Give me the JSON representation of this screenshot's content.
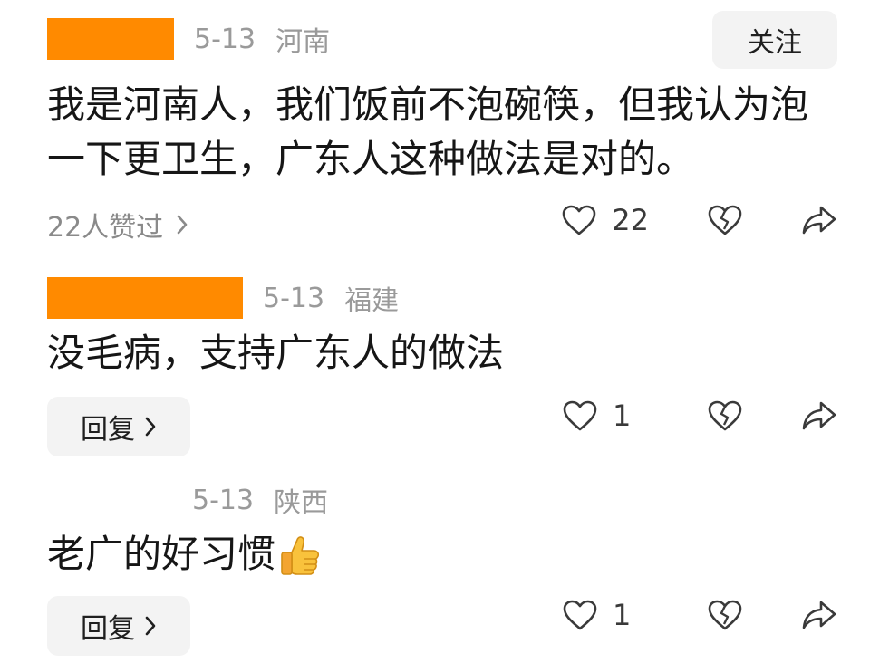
{
  "comments": [
    {
      "date": "5-13",
      "location": "河南",
      "follow_label": "关注",
      "text": "我是河南人，我们饭前不泡碗筷，但我认为泡一下更卫生，广东人这种做法是对的。",
      "likes_summary": "22人赞过",
      "like_count": "22"
    },
    {
      "date": "5-13",
      "location": "福建",
      "text": "没毛病，支持广东人的做法",
      "reply_label": "回复",
      "like_count": "1"
    },
    {
      "date": "5-13",
      "location": "陕西",
      "text": "老广的好习惯",
      "reply_label": "回复",
      "like_count": "1"
    }
  ],
  "colors": {
    "redaction": "#ff8a00",
    "meta_gray": "#9a9a9a",
    "button_bg": "#f3f3f3"
  },
  "icons": [
    "heart-outline-icon",
    "broken-heart-icon",
    "share-arrow-icon",
    "chevron-right-icon",
    "thumbs-up-emoji"
  ]
}
